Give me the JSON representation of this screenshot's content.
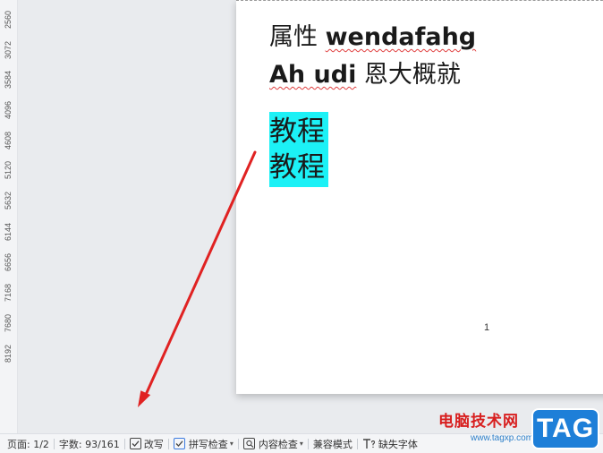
{
  "ruler": {
    "ticks": [
      "2560",
      "3072",
      "3584",
      "4096",
      "4608",
      "5120",
      "5632",
      "6144",
      "6656",
      "7168",
      "7680",
      "8192"
    ]
  },
  "document": {
    "line1": {
      "text": "属性 ",
      "bold_text": "wendafahg"
    },
    "line2": {
      "bold_text": "Ah udi",
      "text": " 恩大概就"
    },
    "highlighted_lines": [
      "教程",
      "教程"
    ],
    "highlight_color": "#1cf1f6",
    "page_number": "1"
  },
  "annotation": {
    "arrow_color": "#e02222"
  },
  "statusbar": {
    "page": "页面: 1/2",
    "word_count": "字数: 93/161",
    "revise": "改写",
    "spell_check": "拼写检查",
    "content_check": "内容检查",
    "compat_mode": "兼容模式",
    "missing_font": "缺失字体"
  },
  "watermark": {
    "site_name": "电脑技术网",
    "url": "www.tagxp.com",
    "logo_text": "TAG",
    "logo_color": "#1e7fd8"
  }
}
